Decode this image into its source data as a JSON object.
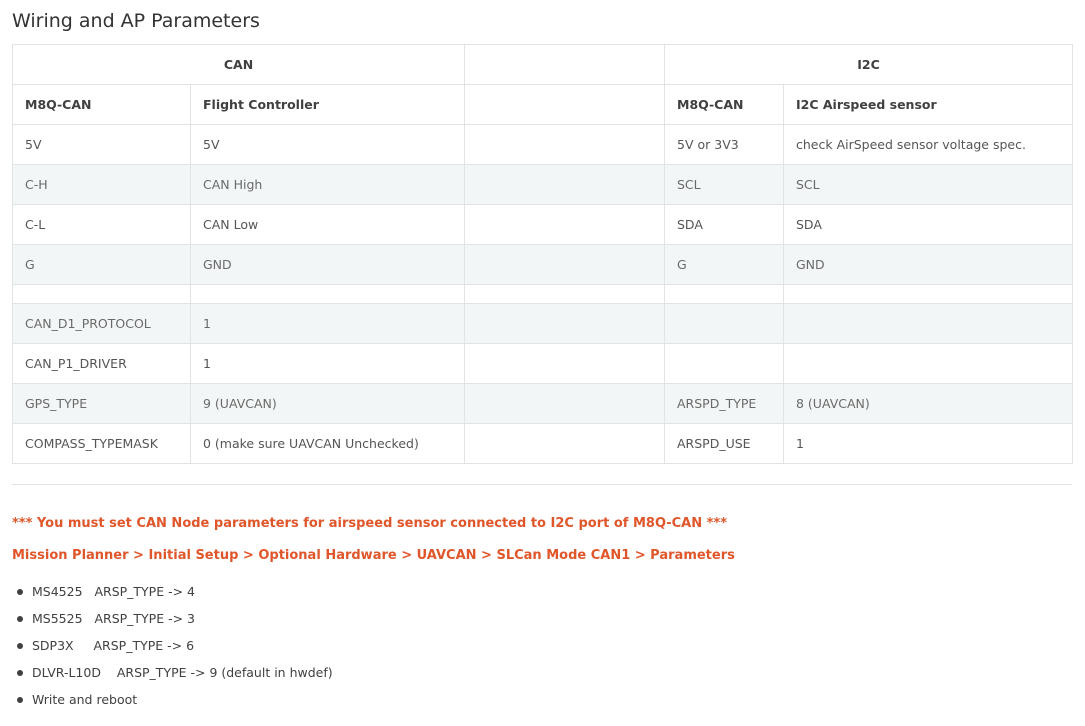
{
  "title": "Wiring and AP Parameters",
  "table": {
    "group_headers": [
      "CAN",
      "",
      "I2C"
    ],
    "column_headers": [
      "M8Q-CAN",
      "Flight Controller",
      "",
      "M8Q-CAN",
      "I2C Airspeed sensor"
    ],
    "rows": [
      [
        "5V",
        "5V",
        "",
        "5V or 3V3",
        "check AirSpeed sensor voltage spec."
      ],
      [
        "C-H",
        "CAN High",
        "",
        "SCL",
        "SCL"
      ],
      [
        "C-L",
        "CAN Low",
        "",
        "SDA",
        "SDA"
      ],
      [
        "G",
        "GND",
        "",
        "G",
        "GND"
      ],
      [
        "",
        "",
        "",
        "",
        ""
      ],
      [
        "CAN_D1_PROTOCOL",
        "1",
        "",
        "",
        ""
      ],
      [
        "CAN_P1_DRIVER",
        "1",
        "",
        "",
        ""
      ],
      [
        "GPS_TYPE",
        "9 (UAVCAN)",
        "",
        "ARSPD_TYPE",
        "8 (UAVCAN)"
      ],
      [
        "COMPASS_TYPEMASK",
        "0 (make sure UAVCAN Unchecked)",
        "",
        "ARSPD_USE",
        "1"
      ]
    ]
  },
  "notice": {
    "warning": "*** You must set CAN Node parameters for airspeed sensor connected to I2C port of M8Q-CAN ***",
    "path": "Mission Planner > Initial Setup > Optional Hardware > UAVCAN >  SLCan Mode CAN1  > Parameters"
  },
  "steps": [
    "MS4525   ARSP_TYPE -> 4",
    "MS5525   ARSP_TYPE -> 3",
    "SDP3X     ARSP_TYPE -> 6",
    "DLVR-L10D    ARSP_TYPE -> 9 (default in hwdef)",
    "Write and reboot"
  ],
  "colors": {
    "warning_text": "#e0562b",
    "row_stripe": "#f3f6f6",
    "border": "#e1e4e5"
  }
}
